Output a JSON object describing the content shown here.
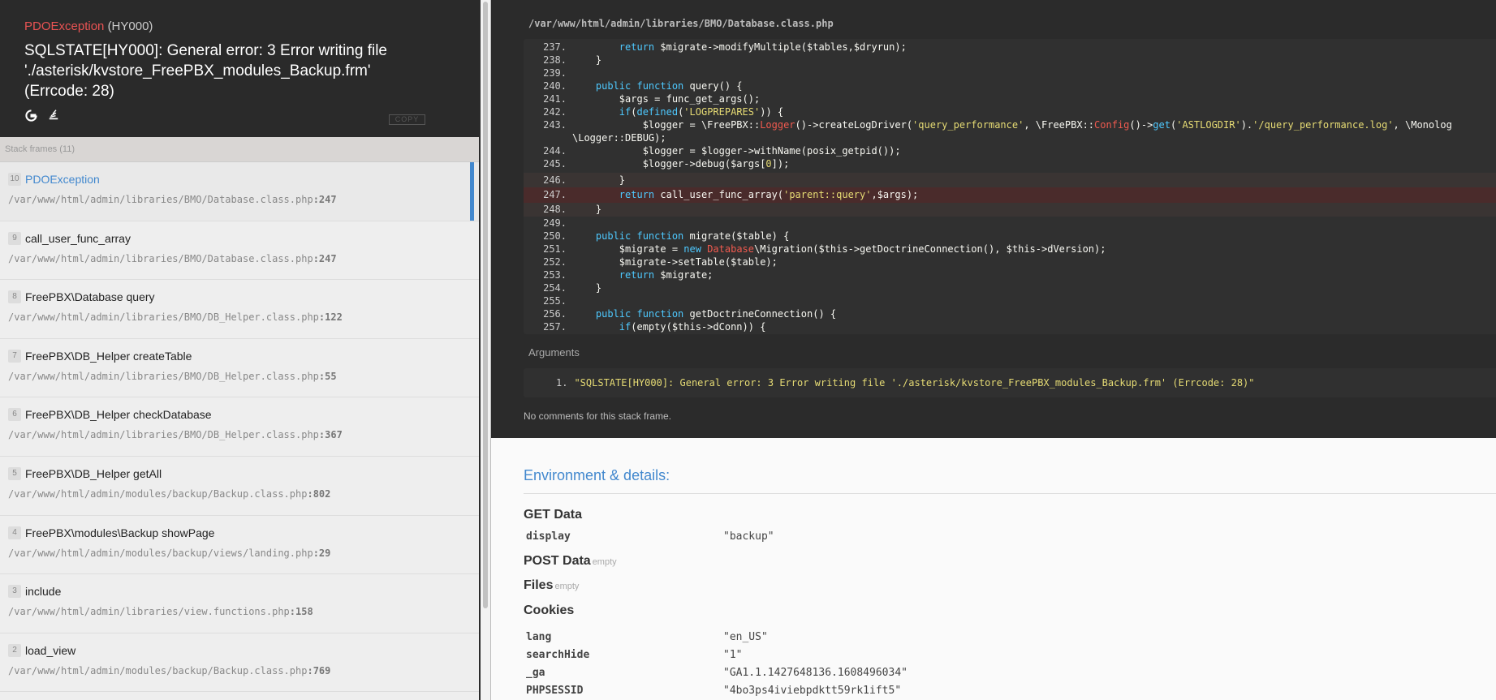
{
  "exception": {
    "class": "PDOException",
    "code": "(HY000)",
    "message": "SQLSTATE[HY000]: General error: 3 Error writing file './asterisk/kvstore_FreePBX_modules_Backup.frm' (Errcode: 28)",
    "copy_label": "COPY",
    "icons": [
      "google-icon",
      "stack-icon"
    ]
  },
  "frames_header": "Stack frames (11)",
  "frames": [
    {
      "index": "10",
      "name": "PDOException",
      "file": "/var/www/html/admin/libraries/BMO/Database.class.php",
      "line": ":247",
      "active": true
    },
    {
      "index": "9",
      "name": "call_user_func_array",
      "file": "/var/www/html/admin/libraries/BMO/Database.class.php",
      "line": ":247"
    },
    {
      "index": "8",
      "name": "FreePBX\\Database query",
      "file": "/var/www/html/admin/libraries/BMO/DB_Helper.class.php",
      "line": ":122"
    },
    {
      "index": "7",
      "name": "FreePBX\\DB_Helper createTable",
      "file": "/var/www/html/admin/libraries/BMO/DB_Helper.class.php",
      "line": ":55"
    },
    {
      "index": "6",
      "name": "FreePBX\\DB_Helper checkDatabase",
      "file": "/var/www/html/admin/libraries/BMO/DB_Helper.class.php",
      "line": ":367"
    },
    {
      "index": "5",
      "name": "FreePBX\\DB_Helper getAll",
      "file": "/var/www/html/admin/modules/backup/Backup.class.php",
      "line": ":802"
    },
    {
      "index": "4",
      "name": "FreePBX\\modules\\Backup showPage",
      "file": "/var/www/html/admin/modules/backup/views/landing.php",
      "line": ":29"
    },
    {
      "index": "3",
      "name": "include",
      "file": "/var/www/html/admin/libraries/view.functions.php",
      "line": ":158"
    },
    {
      "index": "2",
      "name": "load_view",
      "file": "/var/www/html/admin/modules/backup/Backup.class.php",
      "line": ":769"
    }
  ],
  "code_file": "/var/www/html/admin/libraries/BMO/Database.class.php",
  "args_title": "Arguments",
  "args": [
    {
      "num": "1.",
      "value": "\"SQLSTATE[HY000]: General error: 3 Error writing file './asterisk/kvstore_FreePBX_modules_Backup.frm' (Errcode: 28)\""
    }
  ],
  "no_comments": "No comments for this stack frame.",
  "env": {
    "title": "Environment & details:",
    "get_title": "GET Data",
    "get": [
      {
        "key": "display",
        "value": "\"backup\""
      }
    ],
    "post_title": "POST Data",
    "post_empty": "empty",
    "files_title": "Files",
    "files_empty": "empty",
    "cookies_title": "Cookies",
    "cookies": [
      {
        "key": "lang",
        "value": "\"en_US\""
      },
      {
        "key": "searchHide",
        "value": "\"1\""
      },
      {
        "key": "_ga",
        "value": "\"GA1.1.1427648136.1608496034\""
      },
      {
        "key": "PHPSESSID",
        "value": "\"4bo3ps4iviebpdktt59rk1ift5\""
      }
    ]
  }
}
